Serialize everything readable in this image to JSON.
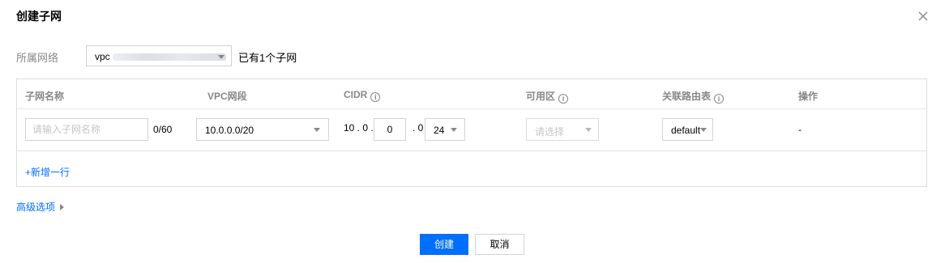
{
  "dialog": {
    "title": "创建子网"
  },
  "vpc": {
    "label": "所属网络",
    "select_prefix": "vpc",
    "hint": "已有1个子网"
  },
  "table": {
    "headers": {
      "name": "子网名称",
      "vpc_cidr": "VPC网段",
      "cidr": "CIDR",
      "zone": "可用区",
      "route_table": "关联路由表",
      "action": "操作"
    },
    "row": {
      "name_placeholder": "请输入子网名称",
      "name_value": "",
      "name_counter": "0/60",
      "vpc_cidr_value": "10.0.0.0/20",
      "cidr_prefix": "10 . 0 .",
      "cidr_octet": "0",
      "cidr_sep": ". 0 /",
      "cidr_mask": "24",
      "zone_placeholder": "请选择",
      "route_table_value": "default",
      "action_value": "-"
    },
    "add_row_label": "+新增一行"
  },
  "advanced_label": "高级选项",
  "footer": {
    "create_label": "创建",
    "cancel_label": "取消"
  },
  "colors": {
    "accent": "#006eff",
    "muted_text": "#888888",
    "border": "#d0d3d9"
  },
  "icons": [
    "close-icon",
    "info-icon",
    "chevron-down-icon",
    "caret-right-icon"
  ]
}
